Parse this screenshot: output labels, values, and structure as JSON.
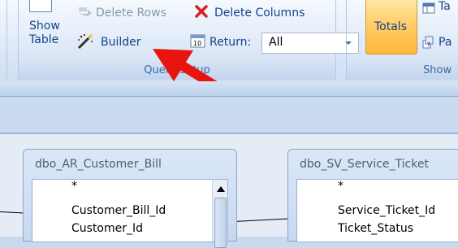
{
  "ribbon": {
    "delete_rows": "Delete Rows",
    "delete_columns": "Delete Columns",
    "show_table_line1": "Show",
    "show_table_line2": "Table",
    "builder": "Builder",
    "return_label": "Return:",
    "return_value": "All",
    "group_query_setup": "Query Setup",
    "totals": "Totals",
    "ta_partial": "Ta",
    "pa_partial": "Pa",
    "group_show_partial": "Show"
  },
  "annotation": {
    "arrow_color": "#e8140f"
  },
  "tables": [
    {
      "title": "dbo_AR_Customer_Bill",
      "fields": [
        "*",
        "Customer_Bill_Id",
        "Customer_Id"
      ]
    },
    {
      "title": "dbo_SV_Service_Ticket",
      "fields": [
        "*",
        "Service_Ticket_Id",
        "Ticket_Status"
      ]
    }
  ]
}
